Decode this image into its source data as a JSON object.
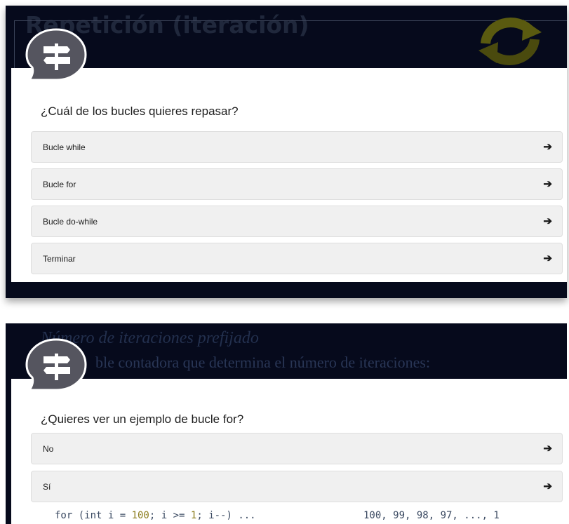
{
  "panel1": {
    "background_title": "Repetición (iteración)",
    "background_icon": "refresh-arrows-icon",
    "dialog_icon": "signpost-chat-bubble-icon",
    "question": "¿Cuál de los bucles quieres repasar?",
    "options": [
      {
        "label": "Bucle while",
        "icon": "arrow-right-icon"
      },
      {
        "label": "Bucle for",
        "icon": "arrow-right-icon"
      },
      {
        "label": "Bucle do-while",
        "icon": "arrow-right-icon"
      },
      {
        "label": "Terminar",
        "icon": "arrow-right-icon"
      }
    ]
  },
  "panel2": {
    "background_subtitle": "Número de iteraciones prefijado",
    "background_line": "ble contadora que determina el número de iteraciones:",
    "background_code": {
      "kw": "for (int i = ",
      "start": "100",
      "mid": "; i >= ",
      "end": "1",
      "rest": "; i--) ..."
    },
    "background_output": "100, 99, 98, 97, ..., 1",
    "dialog_icon": "signpost-chat-bubble-icon",
    "question": "¿Quieres ver un ejemplo de bucle for?",
    "options": [
      {
        "label": "No",
        "icon": "arrow-right-icon"
      },
      {
        "label": "Sí",
        "icon": "arrow-right-icon"
      }
    ]
  },
  "arrow_glyph": "➔",
  "colors": {
    "slide_background": "#060a1c",
    "dialog_background": "#ffffff",
    "option_background": "#f0f0f0",
    "bubble_color": "#55555f",
    "refresh_icon_color": "#5a5a10"
  }
}
